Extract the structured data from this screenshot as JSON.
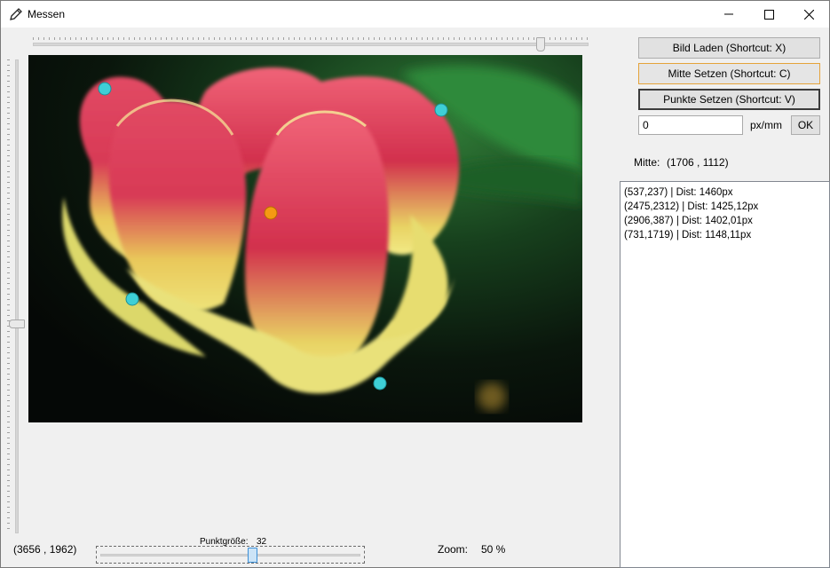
{
  "window": {
    "title": "Messen",
    "icon": "ruler-pencil-icon"
  },
  "title_controls": {
    "minimize_icon": "minimize-icon",
    "maximize_icon": "maximize-icon",
    "close_icon": "close-icon"
  },
  "sliders": {
    "top_zoom_fraction": 0.92,
    "left_vertical_fraction": 0.56,
    "point_size_fraction": 0.59
  },
  "buttons": {
    "load": "Bild Laden (Shortcut: X)",
    "center": "Mitte Setzen (Shortcut: C)",
    "points": "Punkte Setzen (Shortcut: V)",
    "ok": "OK"
  },
  "scale": {
    "value": "0",
    "unit": "px/mm"
  },
  "center": {
    "label": "Mitte:",
    "value": "(1706 , 1112)"
  },
  "points_list": [
    "(537,237) | Dist: 1460px",
    "(2475,2312) | Dist: 1425,12px",
    "(2906,387) | Dist: 1402,01px",
    "(731,1719) | Dist: 1148,11px"
  ],
  "status": {
    "cursor_coords": "(3656 , 1962)",
    "point_size_label": "Punktgröße:",
    "point_size_value": "32",
    "zoom_label": "Zoom:",
    "zoom_value": "50 %"
  },
  "colors": {
    "marker_points": "#3ecfd6",
    "marker_center": "#f59a12",
    "focus_border": "#e5a33a"
  }
}
